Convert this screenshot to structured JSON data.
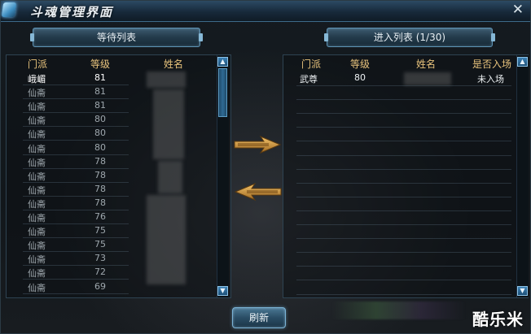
{
  "window": {
    "title": "斗魂管理界面",
    "close_label": "✕"
  },
  "waiting": {
    "header_label": "等待列表",
    "columns": {
      "sect": "门派",
      "level": "等级",
      "name": "姓名"
    },
    "rows": [
      {
        "sect": "峨嵋",
        "level": "81"
      },
      {
        "sect": "仙斋",
        "level": "81"
      },
      {
        "sect": "仙斋",
        "level": "81"
      },
      {
        "sect": "仙斋",
        "level": "80"
      },
      {
        "sect": "仙斋",
        "level": "80"
      },
      {
        "sect": "仙斋",
        "level": "80"
      },
      {
        "sect": "仙斋",
        "level": "78"
      },
      {
        "sect": "仙斋",
        "level": "78"
      },
      {
        "sect": "仙斋",
        "level": "78"
      },
      {
        "sect": "仙斋",
        "level": "78"
      },
      {
        "sect": "仙斋",
        "level": "76"
      },
      {
        "sect": "仙斋",
        "level": "75"
      },
      {
        "sect": "仙斋",
        "level": "75"
      },
      {
        "sect": "仙斋",
        "level": "73"
      },
      {
        "sect": "仙斋",
        "level": "72"
      },
      {
        "sect": "仙斋",
        "level": "69"
      }
    ]
  },
  "entered": {
    "header_label": "进入列表 (1/30)",
    "columns": {
      "sect": "门派",
      "level": "等级",
      "name": "姓名",
      "entered": "是否入场"
    },
    "rows": [
      {
        "sect": "武尊",
        "level": "80",
        "entered": "未入场"
      }
    ]
  },
  "scroll_up_glyph": "▲",
  "scroll_down_glyph": "▼",
  "refresh_label": "刷新",
  "watermark": "酷乐米",
  "icons": {
    "move_right": "arrow-right-icon",
    "move_left": "arrow-left-icon",
    "accent": "#e8c37c"
  }
}
